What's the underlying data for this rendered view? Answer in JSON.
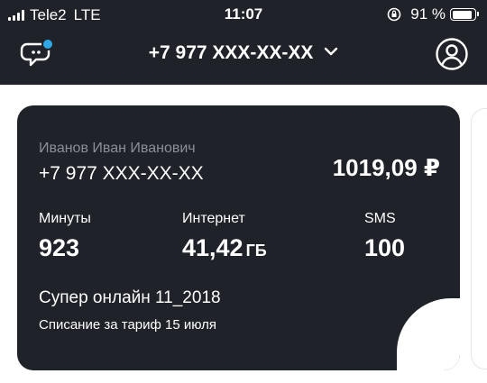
{
  "status_bar": {
    "carrier": "Tele2",
    "network": "LTE",
    "time": "11:07",
    "battery_percent": "91 %",
    "battery_level": 0.91
  },
  "header": {
    "phone_selector": "+7 977 XXX-XX-XX",
    "chat_icon": "chat-bubble-icon",
    "profile_icon": "user-circle-icon",
    "badge_color": "#2fa9e6"
  },
  "card": {
    "owner_name": "Иванов Иван Иванович",
    "phone": "+7 977 XXX-XX-XX",
    "balance": "1019,09 ₽",
    "minutes_label": "Минуты",
    "minutes_value": "923",
    "internet_label": "Интернет",
    "internet_value": "41,42",
    "internet_unit": "ГБ",
    "sms_label": "SMS",
    "sms_value": "100",
    "tariff_name": "Супер онлайн 11_2018",
    "charge_note": "Списание за тариф 15 июля"
  },
  "colors": {
    "dark_bg": "#1f2229",
    "muted_text": "#8c8f96"
  }
}
